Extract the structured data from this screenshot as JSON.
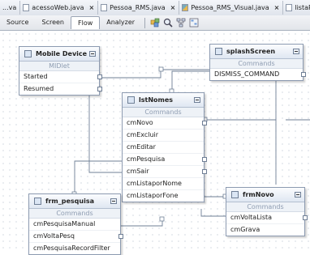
{
  "tabs": [
    {
      "label": "...va"
    },
    {
      "label": "acessoWeb.java"
    },
    {
      "label": "Pessoa_RMS.java"
    },
    {
      "label": "Pessoa_RMS_Visual.java"
    },
    {
      "label": "listaPessoa..."
    }
  ],
  "tab_close": "×",
  "views": {
    "source": "Source",
    "screen": "Screen",
    "flow": "Flow",
    "analyzer": "Analyzer",
    "active": "Flow"
  },
  "section_commands": "Commands",
  "nodes": {
    "mobile_device": {
      "title": "Mobile Device",
      "subtitle": "MIDlet",
      "rows": [
        "Started",
        "Resumed"
      ]
    },
    "splash_screen": {
      "title": "splashScreen",
      "rows": [
        "DISMISS_COMMAND"
      ]
    },
    "lst_nomes": {
      "title": "lstNomes",
      "rows": [
        "cmNovo",
        "cmExcluir",
        "cmEditar",
        "cmPesquisa",
        "cmSair",
        "cmListaporNome",
        "cmListaporFone"
      ]
    },
    "frm_pesquisa": {
      "title": "frm_pesquisa",
      "rows": [
        "cmPesquisaManual",
        "cmVoltaPesq",
        "cmPesquisaRecordFilter"
      ]
    },
    "frm_novo": {
      "title": "frmNovo",
      "rows": [
        "cmVoltaLista",
        "cmGrava"
      ]
    }
  },
  "colors": {
    "wire": "#6f7f96",
    "header_bg": "#dfe7f2",
    "section_text": "#8f9db2"
  },
  "icons": [
    "java-file-icon",
    "mvc-file-icon",
    "mobile-device-icon",
    "screen-icon",
    "list-icon",
    "form-icon"
  ]
}
